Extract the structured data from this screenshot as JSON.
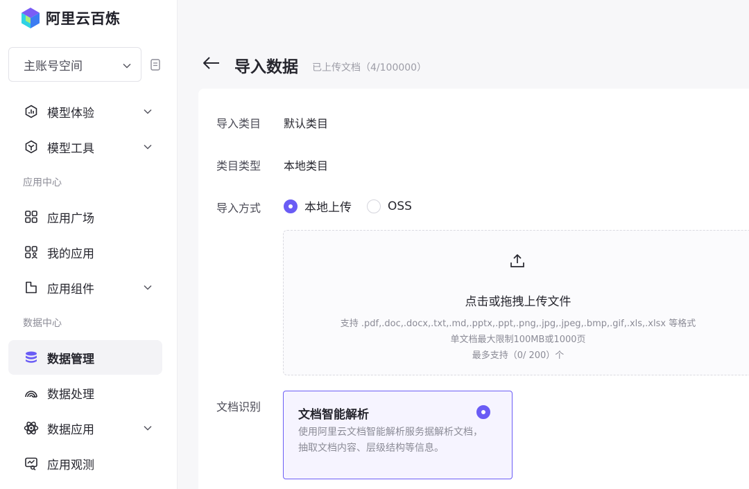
{
  "brand": {
    "name": "阿里云百炼",
    "accent": "#6a5cf5"
  },
  "sidebar": {
    "space_select": "主账号空间",
    "menu": [
      {
        "label": "模型体验",
        "icon": "model-experience-icon",
        "expandable": true
      },
      {
        "label": "模型工具",
        "icon": "model-tools-icon",
        "expandable": true
      }
    ],
    "sections": [
      {
        "title": "应用中心",
        "items": [
          {
            "label": "应用广场",
            "icon": "grid-icon",
            "expandable": false
          },
          {
            "label": "我的应用",
            "icon": "user-apps-icon",
            "expandable": false
          },
          {
            "label": "应用组件",
            "icon": "component-icon",
            "expandable": true
          }
        ]
      },
      {
        "title": "数据中心",
        "items": [
          {
            "label": "数据管理",
            "icon": "database-icon",
            "expandable": false,
            "active": true
          },
          {
            "label": "数据处理",
            "icon": "data-process-icon",
            "expandable": false
          },
          {
            "label": "数据应用",
            "icon": "atom-icon",
            "expandable": true
          },
          {
            "label": "应用观测",
            "icon": "monitor-icon",
            "expandable": false
          }
        ]
      }
    ]
  },
  "header": {
    "title": "导入数据",
    "subtitle": "已上传文档（4/100000）"
  },
  "form": {
    "category_label": "导入类目",
    "category_value": "默认类目",
    "category_type_label": "类目类型",
    "category_type_value": "本地类目",
    "import_method_label": "导入方式",
    "import_options": [
      "本地上传",
      "OSS"
    ],
    "import_selected": "本地上传",
    "upload": {
      "title": "点击或拖拽上传文件",
      "formats": "支持 .pdf,.doc,.docx,.txt,.md,.pptx,.ppt,.png,.jpg,.jpeg,.bmp,.gif,.xls,.xlsx 等格式",
      "limit": "单文档最大限制100MB或1000页",
      "max_count": "最多支持（0/ 200）个"
    },
    "doc_recognition_label": "文档识别",
    "recognition_card": {
      "title": "文档智能解析",
      "description": "使用阿里云文档智能解析服务据解析文档，抽取文档内容、层级结构等信息。",
      "selected": true
    }
  }
}
